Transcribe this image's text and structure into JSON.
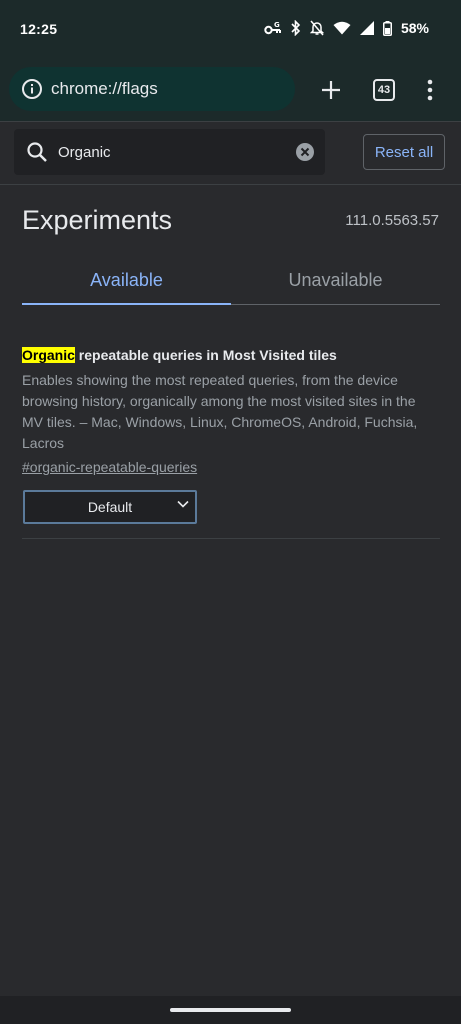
{
  "status_bar": {
    "time": "12:25",
    "battery_percent": "58%"
  },
  "toolbar": {
    "url": "chrome://flags",
    "tab_count": "43"
  },
  "search": {
    "query": "Organic",
    "reset_label": "Reset all"
  },
  "header": {
    "title": "Experiments",
    "version": "111.0.5563.57"
  },
  "tabs": [
    {
      "label": "Available"
    },
    {
      "label": "Unavailable"
    }
  ],
  "experiment": {
    "title_highlight": "Organic",
    "title_rest": " repeatable queries in Most Visited tiles",
    "description": "Enables showing the most repeated queries, from the device browsing history, organically among the most visited sites in the MV tiles. – Mac, Windows, Linux, ChromeOS, Android, Fuchsia, Lacros",
    "link": "#organic-repeatable-queries",
    "selected_option": "Default"
  },
  "colors": {
    "accent": "#8ab4f8",
    "highlight": "#ffff00",
    "background": "#292a2d"
  }
}
